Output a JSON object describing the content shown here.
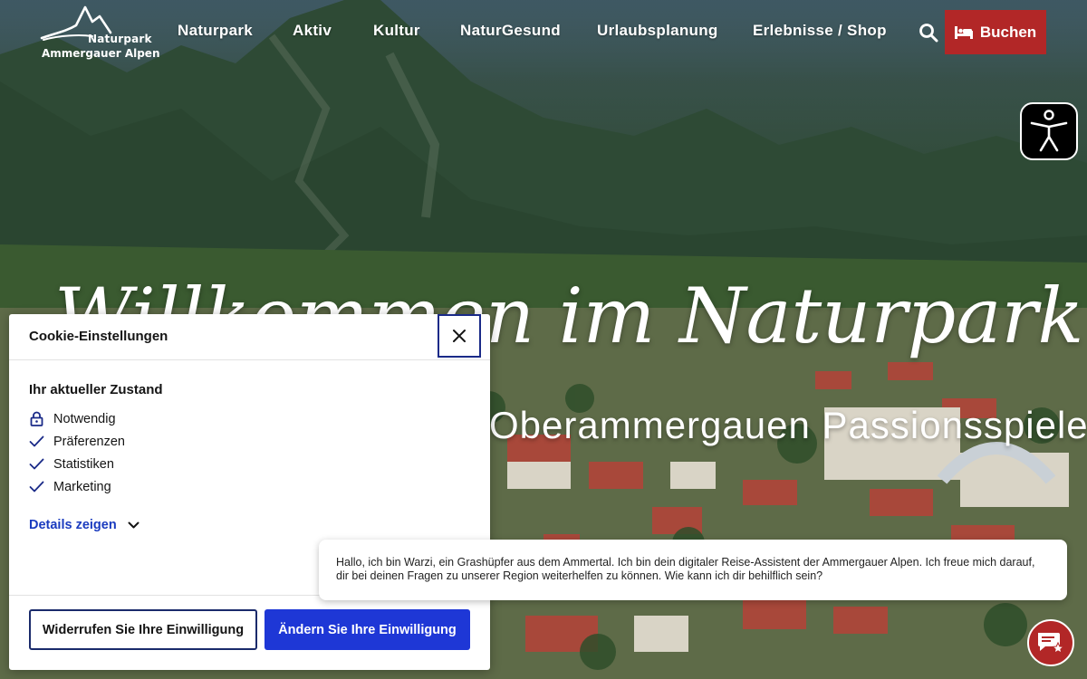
{
  "logo": {
    "line1": "Naturpark",
    "line2": "Ammergauer Alpen",
    "icon": "mountain-logo-icon"
  },
  "nav": {
    "items": [
      {
        "label": "Naturpark"
      },
      {
        "label": "Aktiv"
      },
      {
        "label": "Kultur"
      },
      {
        "label": "NaturGesund"
      },
      {
        "label": "Urlaubsplanung"
      },
      {
        "label": "Erlebnisse / Shop"
      }
    ],
    "search_icon": "search-icon",
    "book_label": "Buchen",
    "book_icon": "bed-icon"
  },
  "accessibility": {
    "icon": "accessibility-person-icon"
  },
  "hero": {
    "title": "Willkommen im Naturpark",
    "subtitle": "Oberammergauen Passionsspiele"
  },
  "cookie": {
    "title": "Cookie-Einstellungen",
    "state_heading": "Ihr aktueller Zustand",
    "items": [
      {
        "label": "Notwendig",
        "icon": "lock-icon"
      },
      {
        "label": "Präferenzen",
        "icon": "check-icon"
      },
      {
        "label": "Statistiken",
        "icon": "check-icon"
      },
      {
        "label": "Marketing",
        "icon": "check-icon"
      }
    ],
    "details_label": "Details zeigen",
    "revoke_label": "Widerrufen Sie Ihre Einwilligung",
    "change_label": "Ändern Sie Ihre Einwilligung"
  },
  "chat": {
    "message": "Hallo, ich bin Warzi, ein Grashüpfer aus dem Ammertal. Ich bin dein digitaler Reise-Assistent der Ammergauer Alpen. Ich freue mich darauf, dir bei deinen Fragen zu unserer Region weiterhelfen zu können. Wie kann ich dir behilflich sein?",
    "icon": "chat-bubble-star-icon"
  },
  "colors": {
    "accent_red": "#b22727",
    "consent_blue": "#1e37d6",
    "link_blue": "#1a3bbf"
  }
}
